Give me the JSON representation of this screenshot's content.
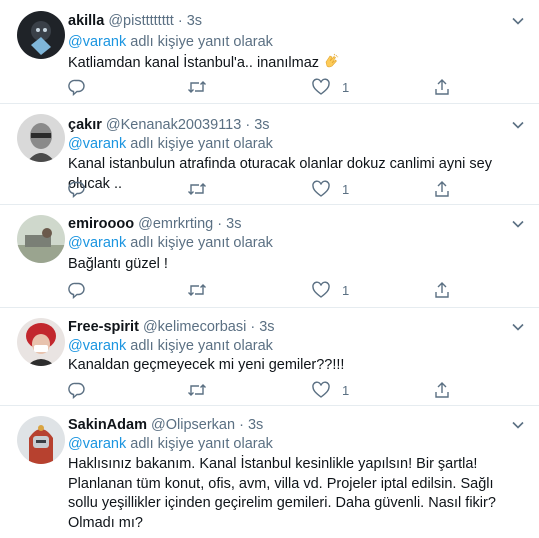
{
  "tweets": [
    {
      "name": "akilla",
      "handle": "@pistttttttt",
      "time": "3s",
      "reply_prefix": "@varank",
      "reply_suffix": " adlı kişiye yanıt olarak",
      "text": "Katliamdan kanal İstanbul'a.. inanılmaz",
      "emoji": "clapping-hands",
      "reply_count": "",
      "retweet_count": "",
      "like_count": "1"
    },
    {
      "name": "çakır",
      "handle": "@Kenanak20039113",
      "time": "3s",
      "reply_prefix": "@varank",
      "reply_suffix": " adlı kişiye yanıt olarak",
      "text": "Kanal istanbulun atrafinda oturacak olanlar dokuz canlimi ayni sey olucak ..",
      "reply_count": "",
      "retweet_count": "",
      "like_count": "1"
    },
    {
      "name": "emiroooo",
      "handle": "@emrkrting",
      "time": "3s",
      "reply_prefix": "@varank",
      "reply_suffix": " adlı kişiye yanıt olarak",
      "text": "Bağlantı güzel !",
      "reply_count": "",
      "retweet_count": "",
      "like_count": "1"
    },
    {
      "name": "Free-spirit",
      "handle": "@kelimecorbasi",
      "time": "3s",
      "reply_prefix": "@varank",
      "reply_suffix": " adlı kişiye yanıt olarak",
      "text": "Kanaldan geçmeyecek mi yeni gemiler??!!!",
      "reply_count": "",
      "retweet_count": "",
      "like_count": "1"
    },
    {
      "name": "SakinAdam",
      "handle": "@Olipserkan",
      "time": "3s",
      "reply_prefix": "@varank",
      "reply_suffix": " adlı kişiye yanıt olarak",
      "text": "Haklısınız bakanım. Kanal İstanbul kesinlikle yapılsın! Bir şartla! Planlanan tüm konut, ofis, avm, villa vd. Projeler iptal edilsin. Sağlı sollu yeşillikler içinden geçirelim gemileri. Daha güvenli. Nasıl fikir? Olmadı mı?"
    }
  ],
  "colors": {
    "mention": "#1b95e0",
    "secondary": "#5b7083",
    "divider": "#e6ecf0"
  }
}
